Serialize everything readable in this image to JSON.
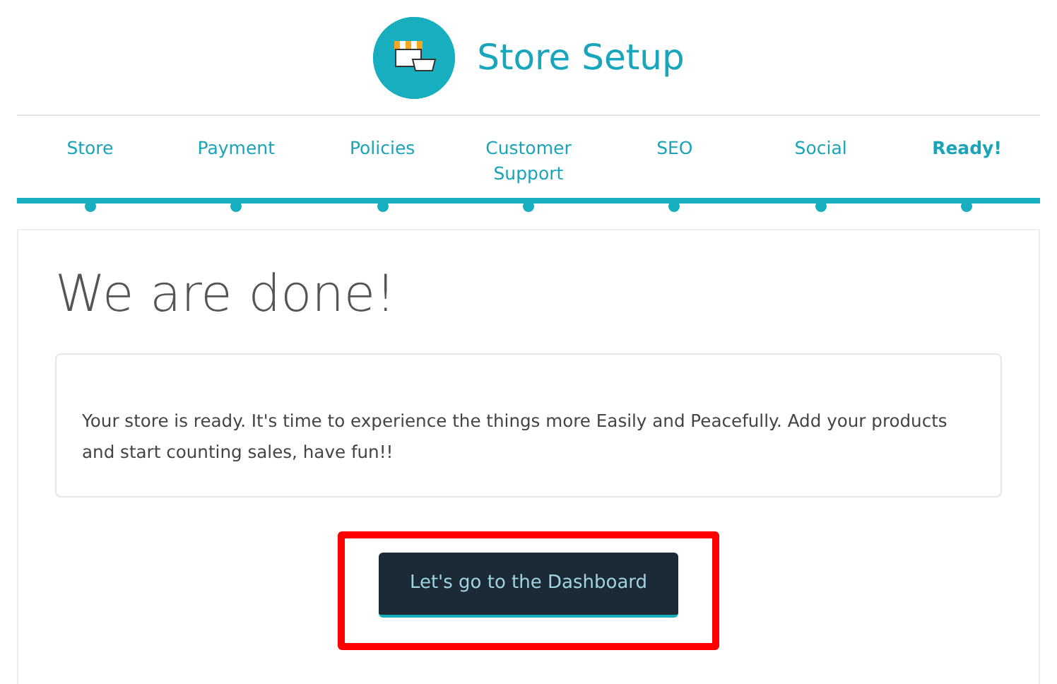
{
  "header": {
    "title": "Store Setup"
  },
  "steps": [
    {
      "label": "Store",
      "selected": false
    },
    {
      "label": "Payment",
      "selected": false
    },
    {
      "label": "Policies",
      "selected": false
    },
    {
      "label": "Customer Support",
      "selected": false
    },
    {
      "label": "SEO",
      "selected": false
    },
    {
      "label": "Social",
      "selected": false
    },
    {
      "label": "Ready!",
      "selected": true
    }
  ],
  "content": {
    "heading": "We are done!",
    "message": "Your store is ready. It's time to experience the things more Easily and Peacefully. Add your products and start counting sales, have fun!!",
    "button": "Let's go to the Dashboard",
    "highlighted": true
  }
}
